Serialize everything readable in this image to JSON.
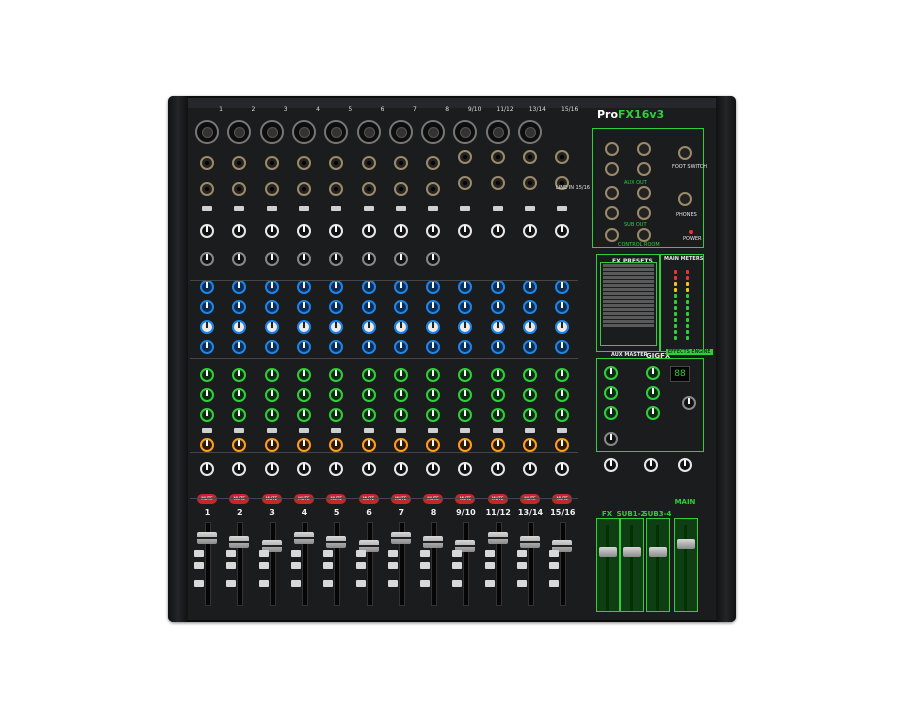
{
  "image": {
    "subject": "mixer-photo",
    "brand": "Pro",
    "model": "FX16v3"
  },
  "channels": [
    {
      "label": "1"
    },
    {
      "label": "2"
    },
    {
      "label": "3"
    },
    {
      "label": "4"
    },
    {
      "label": "5"
    },
    {
      "label": "6"
    },
    {
      "label": "7"
    },
    {
      "label": "8"
    },
    {
      "label": "9/10"
    },
    {
      "label": "11/12"
    },
    {
      "label": "13/14"
    },
    {
      "label": "15/16"
    }
  ],
  "top_numbers": [
    "1",
    "2",
    "3",
    "4",
    "5",
    "6",
    "7",
    "8",
    "9/10",
    "11/12",
    "13/14",
    "15/16"
  ],
  "mute_label": "MUTE",
  "buses": [
    {
      "label": "FX"
    },
    {
      "label": "SUB1-2"
    },
    {
      "label": "SUB3-4"
    },
    {
      "label": "MAIN"
    }
  ],
  "panel_labels": {
    "fx_presets": "FX PRESETS",
    "main_meters": "MAIN METERS",
    "aux_master": "AUX MASTER",
    "gigfx": "GIGFX",
    "effects_engine": "EFFECTS ENGINE",
    "aux_out": "AUX OUT",
    "sub_out": "SUB OUT",
    "control_room": "CONTROL ROOM",
    "foot_switch": "FOOT SWITCH",
    "phones": "PHONES",
    "power": "POWER",
    "line_in_15_16": "LINE IN 15/16",
    "fx_display": "88"
  },
  "colors": {
    "panel": "#1b1c1e",
    "accent_green": "#2fcf3a",
    "eq_blue": "#1e84e6",
    "pan_orange": "#ff9f1a",
    "mute_red": "#c0282b"
  }
}
